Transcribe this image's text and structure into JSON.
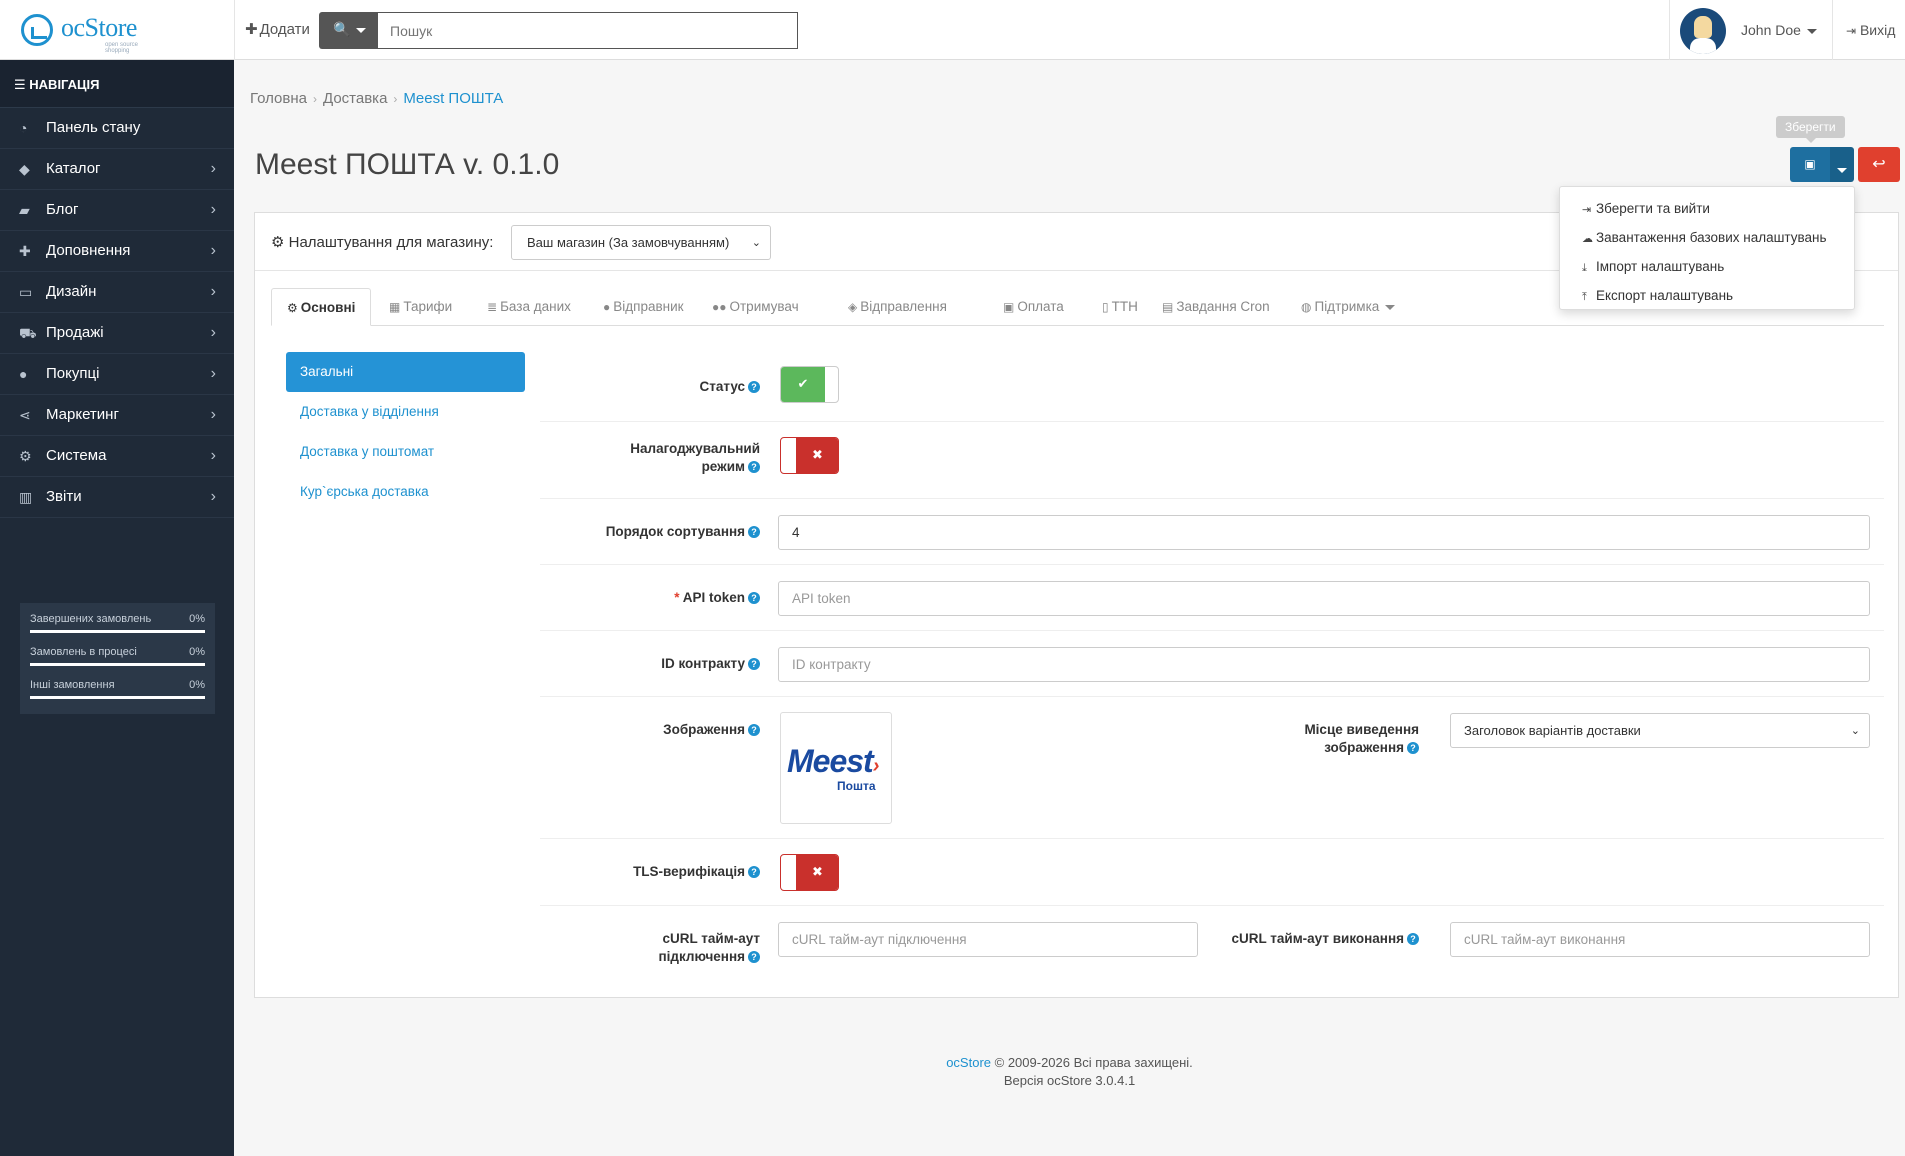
{
  "header": {
    "logo_brand": "ocStore",
    "logo_tagline": "open source shopping",
    "add_label": "Додати",
    "search_placeholder": "Пошук",
    "user_name": "John Doe",
    "logout_label": "Вихід"
  },
  "sidebar": {
    "heading": "НАВІГАЦІЯ",
    "items": [
      {
        "label": "Панель стану",
        "icon": "dashboard-icon",
        "has_children": false
      },
      {
        "label": "Каталог",
        "icon": "tags-icon",
        "has_children": true
      },
      {
        "label": "Блог",
        "icon": "book-icon",
        "has_children": true
      },
      {
        "label": "Доповнення",
        "icon": "puzzle-icon",
        "has_children": true
      },
      {
        "label": "Дизайн",
        "icon": "monitor-icon",
        "has_children": true
      },
      {
        "label": "Продажі",
        "icon": "cart-icon",
        "has_children": true
      },
      {
        "label": "Покупці",
        "icon": "user-icon",
        "has_children": true
      },
      {
        "label": "Маркетинг",
        "icon": "share-icon",
        "has_children": true
      },
      {
        "label": "Система",
        "icon": "gear-icon",
        "has_children": true
      },
      {
        "label": "Звіти",
        "icon": "bar-chart-icon",
        "has_children": true
      }
    ],
    "stats": [
      {
        "label": "Завершених замовлень",
        "value": "0%"
      },
      {
        "label": "Замовлень в процесі",
        "value": "0%"
      },
      {
        "label": "Інші замовлення",
        "value": "0%"
      }
    ]
  },
  "breadcrumb": [
    "Головна",
    "Доставка",
    "Meest ПОШТА"
  ],
  "page_title": "Meest ПОШТА v. 0.1.0",
  "toolbar": {
    "save_tooltip": "Зберегти",
    "dropdown_items": [
      {
        "label": "Зберегти та вийти",
        "icon": "sign-out-icon"
      },
      {
        "label": "Завантаження базових налаштувань",
        "icon": "cloud-download-icon"
      },
      {
        "label": "Імпорт налаштувань",
        "icon": "download-icon"
      },
      {
        "label": "Експорт налаштувань",
        "icon": "upload-icon"
      }
    ]
  },
  "store_settings": {
    "label": "Налаштування для магазину:",
    "selected": "Ваш магазин (За замовчуванням)"
  },
  "tabs": [
    {
      "label": "Основні",
      "icon": "cogs-icon",
      "active": true
    },
    {
      "label": "Тарифи",
      "icon": "calculator-icon",
      "active": false
    },
    {
      "label": "База даних",
      "icon": "database-icon",
      "active": false
    },
    {
      "label": "Відправник",
      "icon": "user-icon",
      "active": false
    },
    {
      "label": "Отримувач",
      "icon": "users-icon",
      "active": false
    },
    {
      "label": "Відправлення",
      "icon": "cube-icon",
      "active": false
    },
    {
      "label": "Оплата",
      "icon": "money-icon",
      "active": false
    },
    {
      "label": "ТТН",
      "icon": "file-icon",
      "active": false
    },
    {
      "label": "Завдання Cron",
      "icon": "tasks-icon",
      "active": false
    },
    {
      "label": "Підтримка",
      "icon": "globe-icon",
      "active": false
    }
  ],
  "subnav": [
    {
      "label": "Загальні",
      "active": true
    },
    {
      "label": "Доставка у відділення",
      "active": false
    },
    {
      "label": "Доставка у поштомат",
      "active": false
    },
    {
      "label": "Кур`єрська доставка",
      "active": false
    }
  ],
  "form": {
    "status_label": "Статус",
    "status_on": true,
    "debug_label_1": "Налагоджувальний",
    "debug_label_2": "режим",
    "debug_on": false,
    "sort_label": "Порядок сортування",
    "sort_value": "4",
    "api_label": "API token",
    "api_placeholder": "API token",
    "contract_label": "ID контракту",
    "contract_placeholder": "ID контракту",
    "image_label": "Зображення",
    "image_brand": "Meest",
    "image_brand_sub": "Пошта",
    "image_place_label_1": "Місце виведення",
    "image_place_label_2": "зображення",
    "image_place_selected": "Заголовок варіантів доставки",
    "tls_label": "TLS-верифікація",
    "tls_on": false,
    "curl_connect_label_1": "cURL тайм-аут",
    "curl_connect_label_2": "підключення",
    "curl_connect_placeholder": "cURL тайм-аут підключення",
    "curl_exec_label": "cURL тайм-аут виконання",
    "curl_exec_placeholder": "cURL тайм-аут виконання"
  },
  "footer": {
    "brand": "ocStore",
    "copyright": "© 2009-2026 Всі права захищені.",
    "version": "Версія ocStore 3.0.4.1"
  }
}
